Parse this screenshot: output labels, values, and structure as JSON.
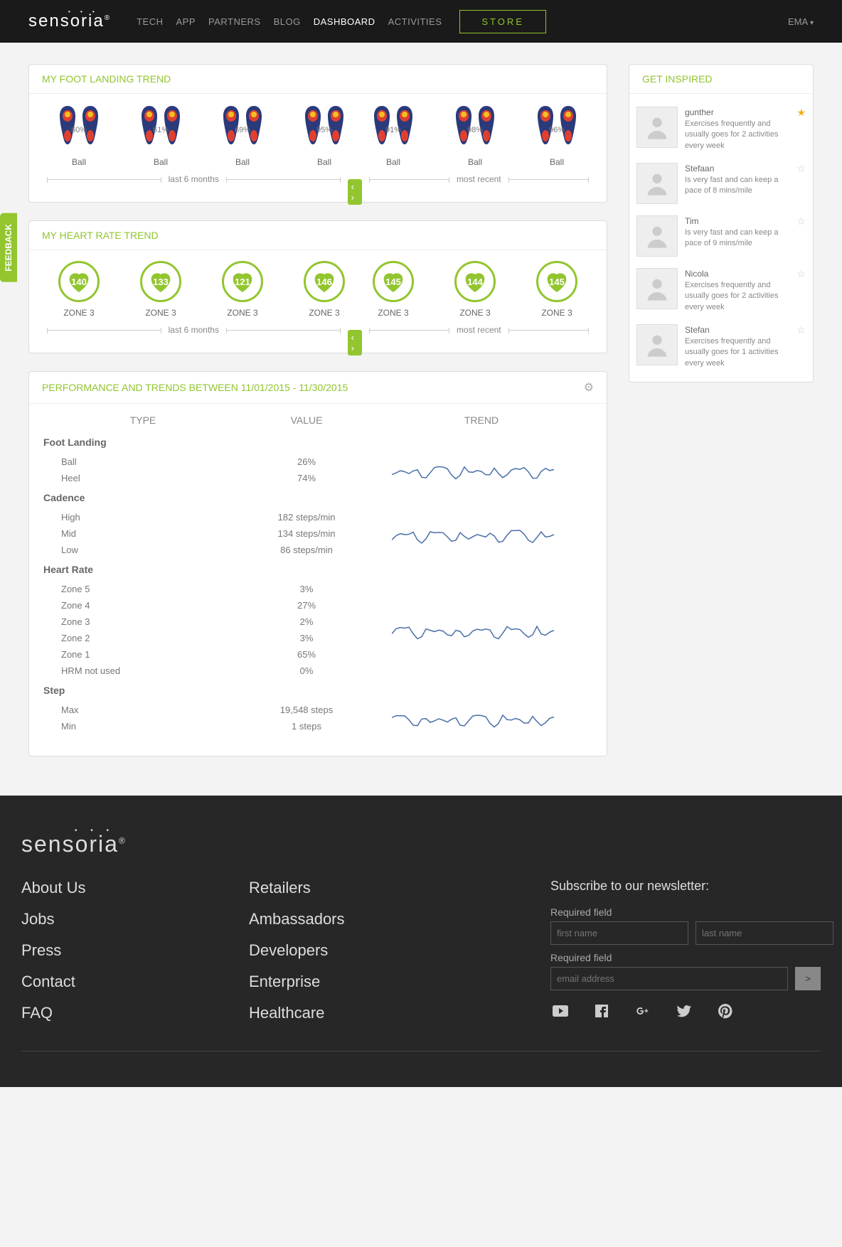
{
  "brand": "sensoria",
  "nav": [
    "TECH",
    "APP",
    "PARTNERS",
    "BLOG",
    "DASHBOARD",
    "ACTIVITIES"
  ],
  "nav_active_index": 4,
  "store_label": "STORE",
  "user_label": "EMA",
  "feedback_label": "FEEDBACK",
  "foot_panel": {
    "title": "MY FOOT LANDING TREND",
    "last6": [
      {
        "pct": "60%",
        "label": "Ball"
      },
      {
        "pct": "61%",
        "label": "Ball"
      },
      {
        "pct": "69%",
        "label": "Ball"
      },
      {
        "pct": "95%",
        "label": "Ball"
      }
    ],
    "recent": [
      {
        "pct": "91%",
        "label": "Ball"
      },
      {
        "pct": "98%",
        "label": "Ball"
      },
      {
        "pct": "96%",
        "label": "Ball"
      }
    ],
    "caption_left": "last 6 months",
    "caption_right": "most recent"
  },
  "heart_panel": {
    "title": "MY HEART RATE TREND",
    "last6": [
      {
        "v": "140",
        "z": "ZONE 3"
      },
      {
        "v": "133",
        "z": "ZONE 3"
      },
      {
        "v": "121",
        "z": "ZONE 3"
      },
      {
        "v": "146",
        "z": "ZONE 3"
      }
    ],
    "recent": [
      {
        "v": "145",
        "z": "ZONE 3"
      },
      {
        "v": "144",
        "z": "ZONE 3"
      },
      {
        "v": "145",
        "z": "ZONE 3"
      }
    ],
    "caption_left": "last 6 months",
    "caption_right": "most recent"
  },
  "perf_panel": {
    "title": "PERFORMANCE AND TRENDS BETWEEN 11/01/2015 - 11/30/2015",
    "headers": {
      "type": "TYPE",
      "value": "VALUE",
      "trend": "TREND"
    },
    "groups": [
      {
        "cat": "Foot Landing",
        "rows": [
          {
            "t": "Ball",
            "v": "26%"
          },
          {
            "t": "Heel",
            "v": "74%"
          }
        ],
        "spark": true
      },
      {
        "cat": "Cadence",
        "rows": [
          {
            "t": "High",
            "v": "182 steps/min"
          },
          {
            "t": "Mid",
            "v": "134 steps/min"
          },
          {
            "t": "Low",
            "v": "86 steps/min"
          }
        ],
        "spark": true
      },
      {
        "cat": "Heart Rate",
        "rows": [
          {
            "t": "Zone 5",
            "v": "3%"
          },
          {
            "t": "Zone 4",
            "v": "27%"
          },
          {
            "t": "Zone 3",
            "v": "2%"
          },
          {
            "t": "Zone 2",
            "v": "3%"
          },
          {
            "t": "Zone 1",
            "v": "65%"
          },
          {
            "t": "HRM not used",
            "v": "0%"
          }
        ],
        "spark": true
      },
      {
        "cat": "Step",
        "rows": [
          {
            "t": "Max",
            "v": "19,548 steps"
          },
          {
            "t": "Min",
            "v": "1 steps"
          }
        ],
        "spark": true
      }
    ]
  },
  "inspired": {
    "title": "GET INSPIRED",
    "people": [
      {
        "name": "gunther",
        "desc": "Exercises frequently and usually goes for 2 activities every week",
        "star": true
      },
      {
        "name": "Stefaan",
        "desc": "Is very fast and can keep a pace of 8 mins/mile",
        "star": false
      },
      {
        "name": "Tim",
        "desc": "Is very fast and can keep a pace of 9 mins/mile",
        "star": false
      },
      {
        "name": "Nicola",
        "desc": "Exercises frequently and usually goes for 2 activities every week",
        "star": false
      },
      {
        "name": "Stefan",
        "desc": "Exercises frequently and usually goes for 1 activities every week",
        "star": false
      }
    ]
  },
  "footer": {
    "col1": [
      "About Us",
      "Jobs",
      "Press",
      "Contact",
      "FAQ"
    ],
    "col2": [
      "Retailers",
      "Ambassadors",
      "Developers",
      "Enterprise",
      "Healthcare"
    ],
    "sub_title": "Subscribe to our newsletter:",
    "req": "Required field",
    "ph_first": "first name",
    "ph_last": "last name",
    "ph_email": "email address",
    "submit": ">"
  }
}
